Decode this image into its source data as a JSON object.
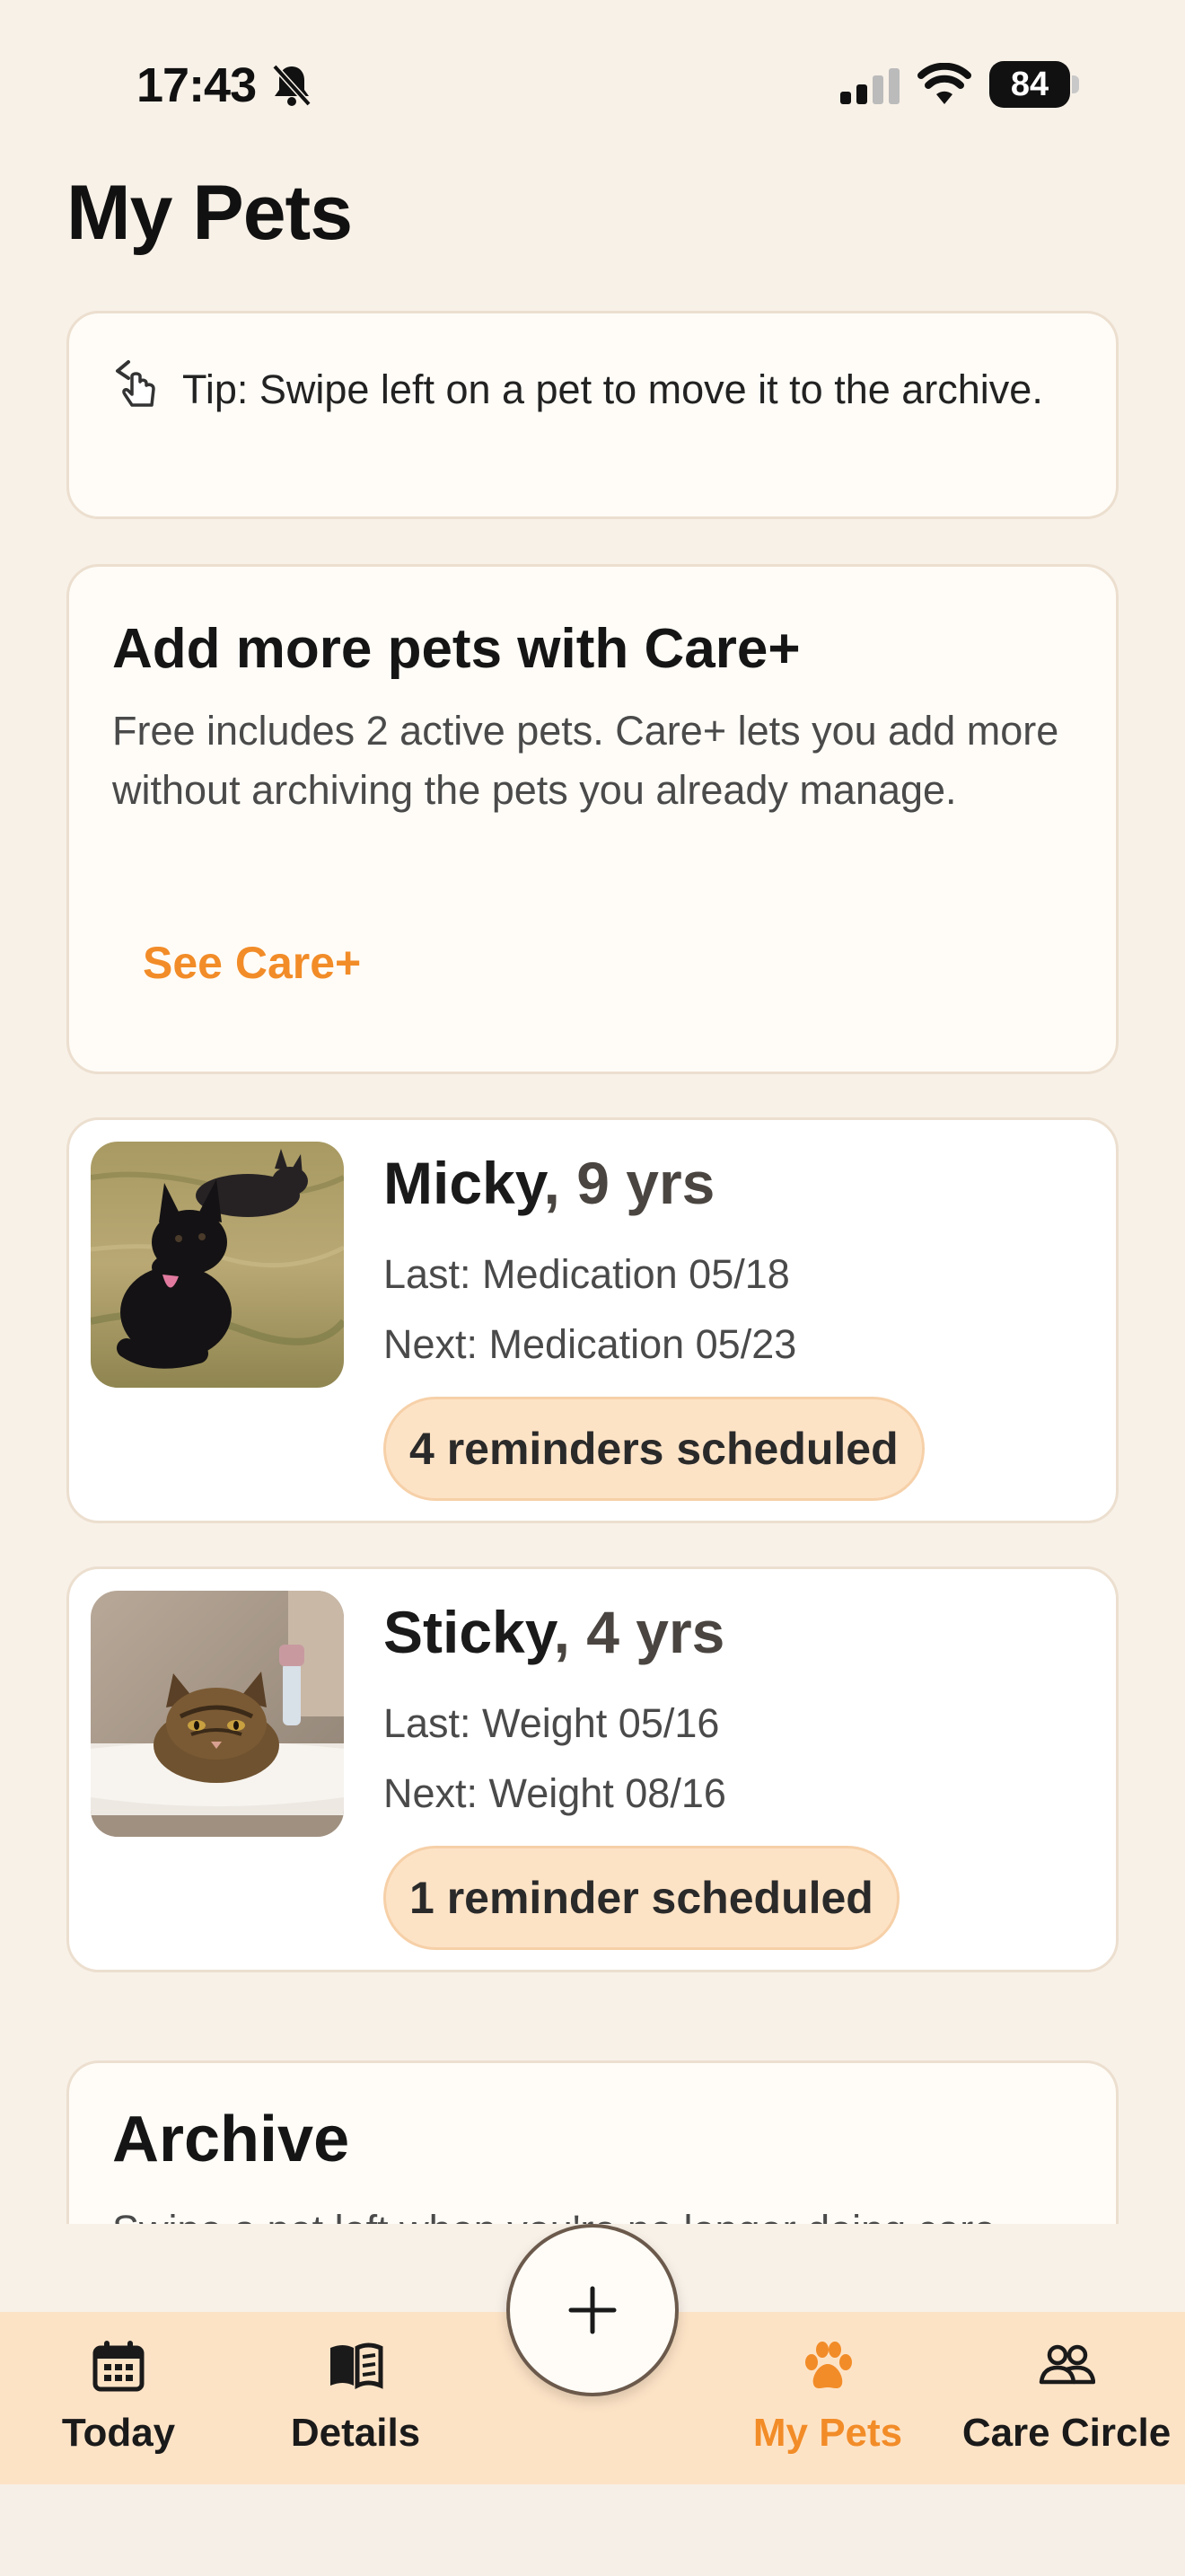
{
  "status_bar": {
    "time": "17:43",
    "battery": "84",
    "icons": [
      "bell-slash-icon",
      "cellular-signal-icon",
      "wifi-icon",
      "battery-icon"
    ]
  },
  "page": {
    "title": "My Pets"
  },
  "tip": {
    "icon": "swipe-hand-icon",
    "text": "Tip: Swipe left on a pet to move it to the archive."
  },
  "upsell": {
    "title": "Add more pets with Care+",
    "description": "Free includes 2 active pets. Care+ lets you add more without archiving the pets you already manage.",
    "link_label": "See Care+"
  },
  "pets": [
    {
      "name": "Micky",
      "age": ", 9 yrs",
      "last": "Last: Medication 05/18",
      "next": "Next: Medication 05/23",
      "badge": "4 reminders scheduled",
      "photo": "black-dog-photo"
    },
    {
      "name": "Sticky",
      "age": ", 4 yrs",
      "last": "Last: Weight 05/16",
      "next": "Next: Weight 08/16",
      "badge": "1 reminder scheduled",
      "photo": "tabby-cat-photo"
    }
  ],
  "archive": {
    "title": "Archive",
    "subtitle": "Swipe a pet left when you're no longer doing care"
  },
  "tab_bar": {
    "tabs": [
      {
        "label": "Today",
        "icon": "calendar-icon",
        "active": false
      },
      {
        "label": "Details",
        "icon": "book-icon",
        "active": false
      },
      {
        "label": "My Pets",
        "icon": "paw-icon",
        "active": true
      },
      {
        "label": "Care Circle",
        "icon": "people-icon",
        "active": false
      }
    ],
    "fab_icon": "plus-icon"
  },
  "colors": {
    "accent": "#f28c28",
    "background": "#f8f1e8",
    "badge": "#fde3c6"
  }
}
